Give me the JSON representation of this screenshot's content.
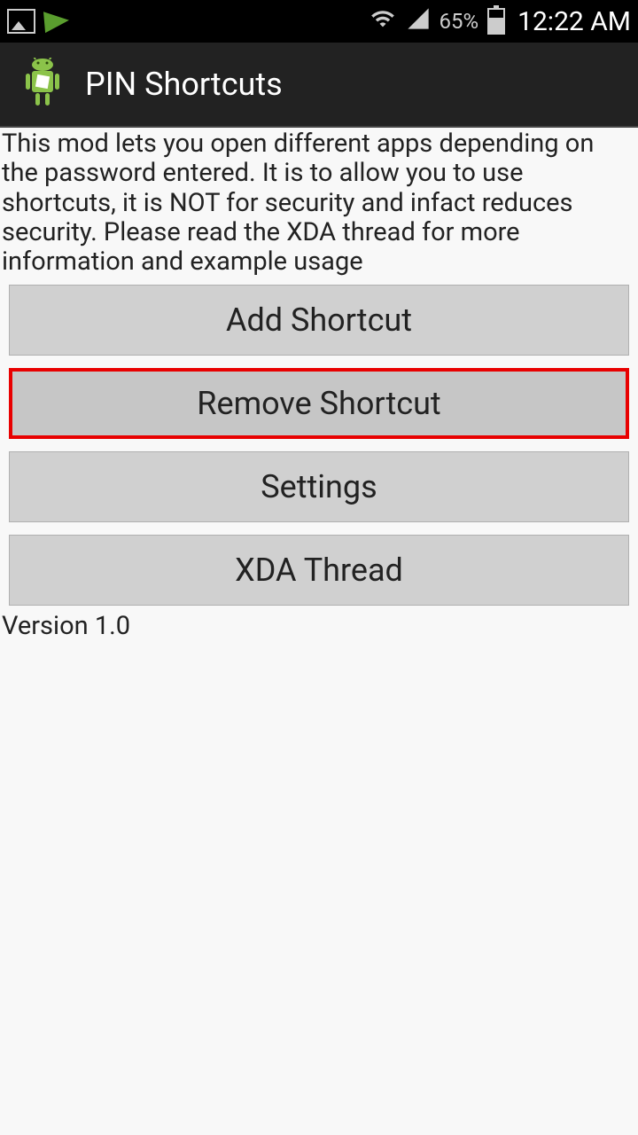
{
  "statusBar": {
    "batteryPercent": "65%",
    "time": "12:22 AM"
  },
  "appBar": {
    "title": "PIN Shortcuts"
  },
  "main": {
    "description": "This mod lets you open different apps depending on the password entered. It is to allow you to use shortcuts, it is NOT for security and infact reduces security. Please read the XDA thread for more information and example usage",
    "buttons": {
      "addShortcut": "Add Shortcut",
      "removeShortcut": "Remove Shortcut",
      "settings": "Settings",
      "xdaThread": "XDA Thread"
    },
    "version": "Version 1.0"
  }
}
